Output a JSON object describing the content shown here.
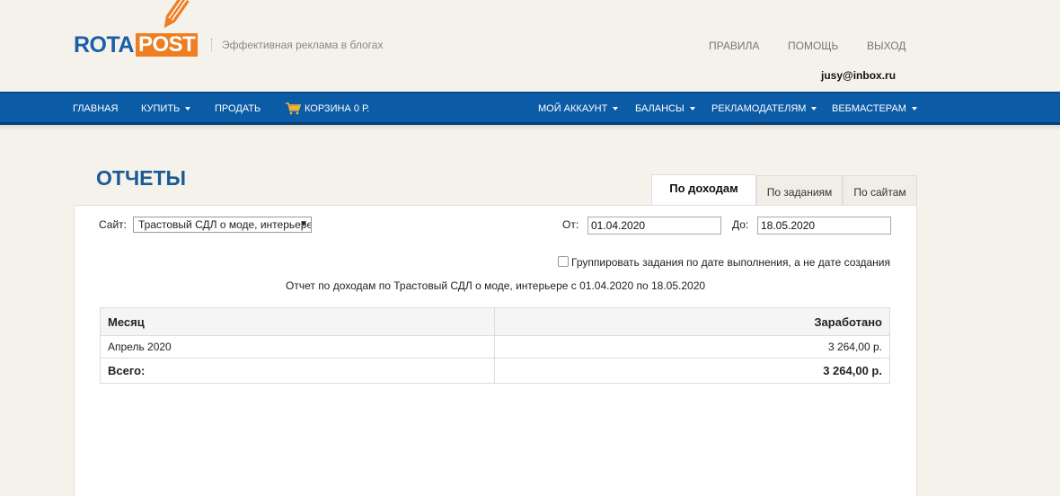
{
  "brand": {
    "part1": "ROTA",
    "part2": "POST",
    "tagline": "Эффективная реклама в блогах"
  },
  "top_links": {
    "rules": "ПРАВИЛА",
    "help": "ПОМОЩЬ",
    "logout": "ВЫХОД"
  },
  "user": {
    "email": "jusy@inbox.ru"
  },
  "nav": {
    "home": "ГЛАВНАЯ",
    "buy": "КУПИТЬ",
    "sell": "ПРОДАТЬ",
    "cart": "КОРЗИНА 0 Р.",
    "account": "МОЙ АККАУНТ",
    "balances": "БАЛАНСЫ",
    "advertisers": "РЕКЛАМОДАТЕЛЯМ",
    "webmasters": "ВЕБМАСТЕРАМ"
  },
  "page": {
    "title": "ОТЧЕТЫ"
  },
  "tabs": {
    "income": "По доходам",
    "tasks": "По заданиям",
    "sites": "По сайтам"
  },
  "filters": {
    "site_label": "Сайт:",
    "site_value": "Трастовый СДЛ о моде, интерьере",
    "from_label": "От:",
    "from_value": "01.04.2020",
    "to_label": "До:",
    "to_value": "18.05.2020",
    "group_checkbox_label": "Группировать задания по дате выполнения, а не дате создания",
    "group_checked": false
  },
  "report": {
    "caption": "Отчет по доходам по Трастовый СДЛ о моде, интерьере с 01.04.2020 по 18.05.2020",
    "col_month": "Месяц",
    "col_earned": "Заработано",
    "rows": [
      {
        "month": "Апрель 2020",
        "earned": "3 264,00 р."
      }
    ],
    "total_label": "Всего:",
    "total_value": "3 264,00 р."
  },
  "colors": {
    "nav_bg": "#0c5ba6",
    "brand_blue": "#1a5fa8",
    "brand_orange": "#ef7d22",
    "page_bg": "#f4f2ea"
  },
  "icons": {
    "cart": "cart-icon",
    "pencil": "pencil-logo-icon"
  }
}
